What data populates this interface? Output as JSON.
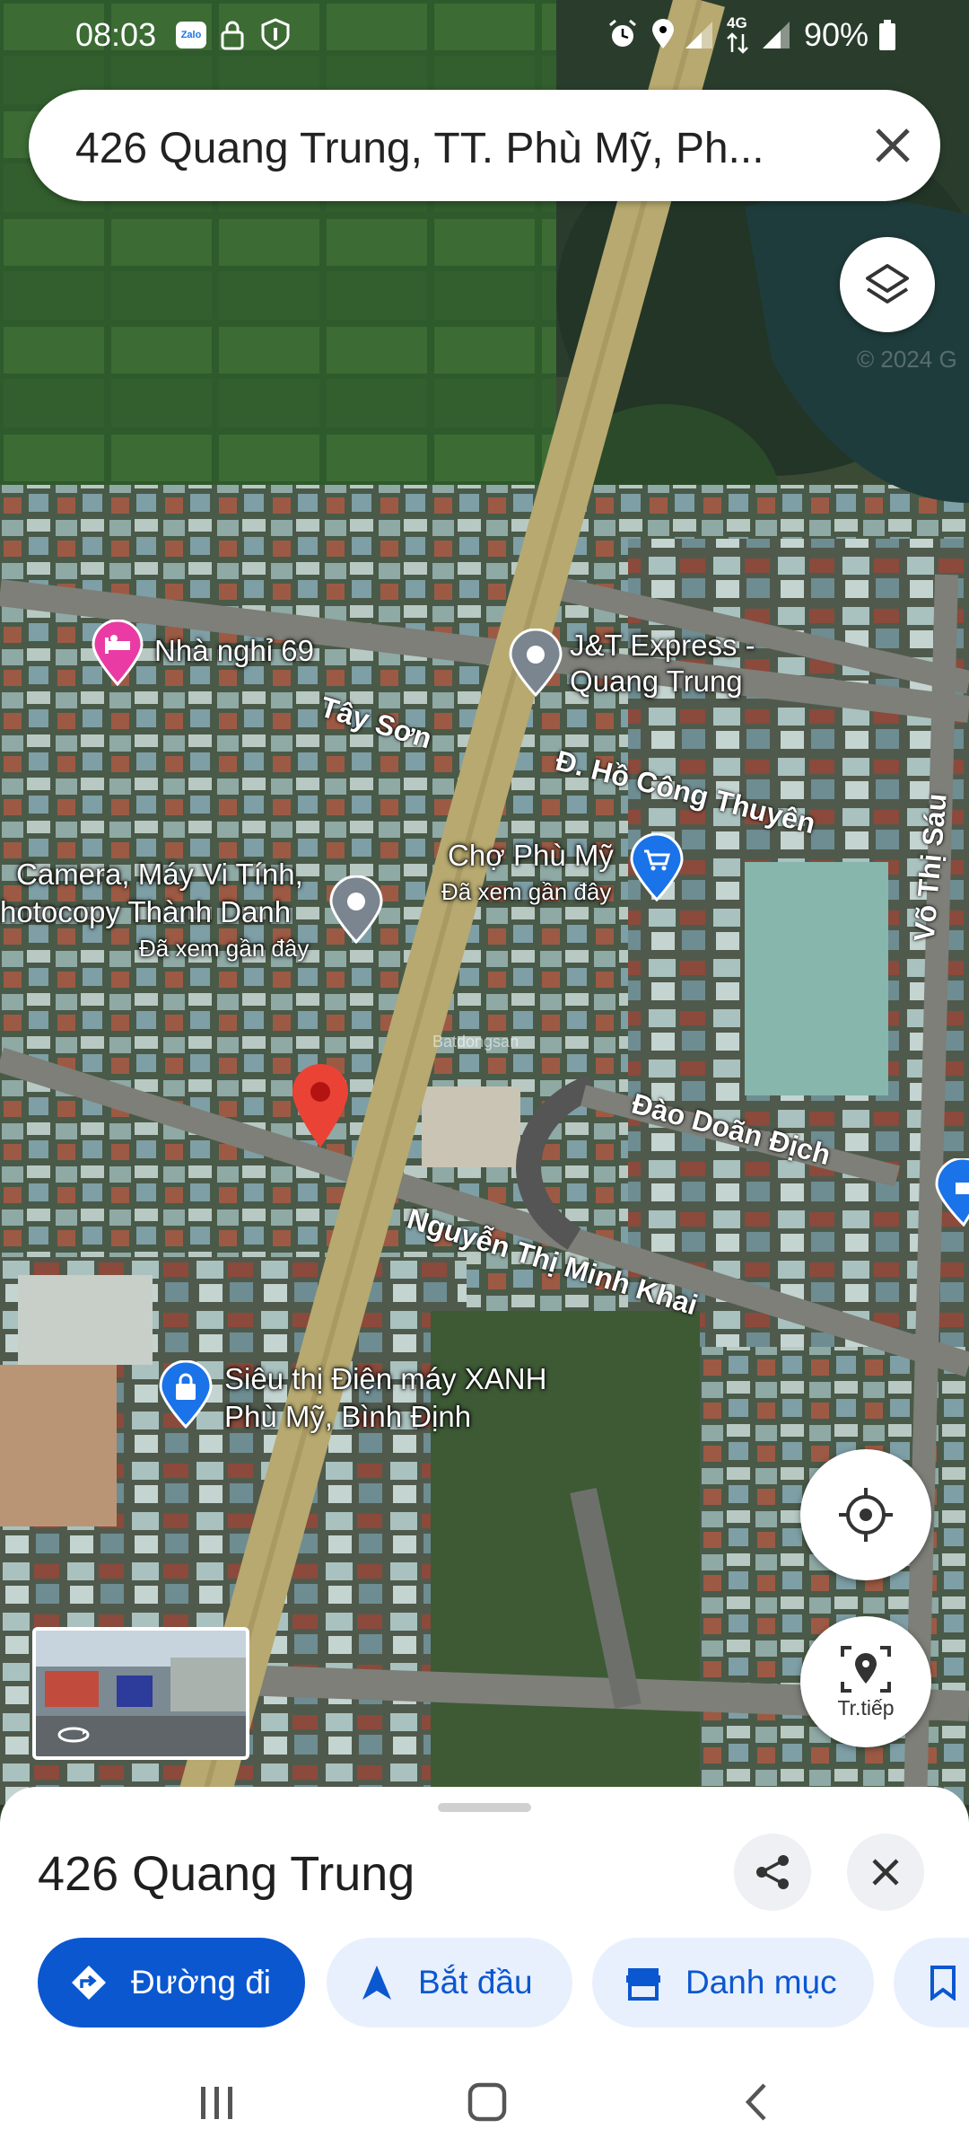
{
  "status_bar": {
    "time": "08:03",
    "battery": "90%",
    "network": "4G",
    "app_icons": [
      "zalo-icon",
      "lock-icon",
      "info-badge-icon"
    ],
    "system_icons": [
      "alarm-icon",
      "location-icon",
      "signal-icon",
      "data-arrows-icon",
      "signal-icon"
    ]
  },
  "search": {
    "query": "426 Quang Trung, TT. Phù Mỹ, Ph..."
  },
  "map": {
    "pois": [
      {
        "name": "Nhà nghỉ 69",
        "icon": "hotel-pin-icon"
      },
      {
        "name": "J&T Express -",
        "name2": "Quang Trung",
        "icon": "place-pin-icon"
      },
      {
        "name": "Chợ Phù Mỹ",
        "sub": "Đã xem gần đây",
        "icon": "shopping-cart-pin-icon"
      },
      {
        "name": "Camera, Máy Vi Tính,",
        "name2": "hotocopy Thành Danh",
        "sub": "Đã xem gần đây",
        "icon": "place-pin-icon"
      },
      {
        "name": "Siêu thị Điện máy XANH",
        "name2": "Phù Mỹ, Bình Định",
        "icon": "shopping-bag-pin-icon"
      }
    ],
    "streets": [
      "Tây Sơn",
      "Đ. Hồ Công Thuyên",
      "Võ Thị Sáu",
      "Đào Doãn Địch",
      "Nguyễn Thị Minh Khai"
    ],
    "street_view_label": "Street View",
    "nearby_label": "Tr.tiếp",
    "watermark": "© 2024 G",
    "small_watermark": "Batdongsan"
  },
  "sheet": {
    "title": "426 Quang Trung",
    "chips": [
      {
        "label": "Đường đi",
        "icon": "directions-icon",
        "primary": true
      },
      {
        "label": "Bắt đầu",
        "icon": "navigation-arrow-icon",
        "primary": false
      },
      {
        "label": "Danh mục",
        "icon": "store-icon",
        "primary": false
      },
      {
        "label": "",
        "icon": "bookmark-icon",
        "primary": false
      }
    ]
  },
  "colors": {
    "primary_blue": "#0b57d0",
    "chip_bg": "#e8f0fe",
    "pin_red": "#ea4335",
    "hotel_pink": "#e93ba3",
    "poi_blue": "#1a73e8"
  }
}
